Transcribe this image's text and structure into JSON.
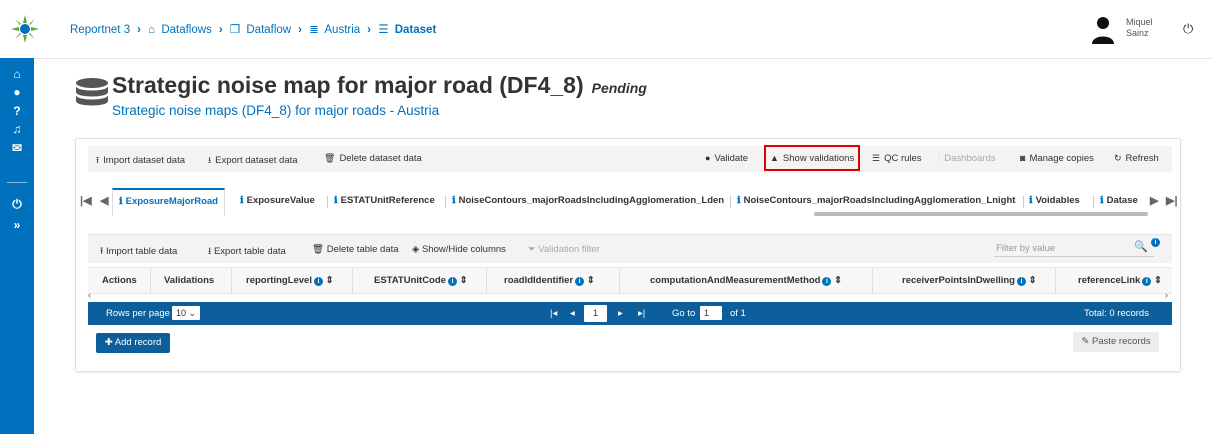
{
  "header": {
    "breadcrumb": [
      "Reportnet 3",
      "Dataflows",
      "Dataflow",
      "Austria",
      "Dataset"
    ],
    "user_first": "Miquel",
    "user_last": "Sainz"
  },
  "page": {
    "title": "Strategic noise map for major road (DF4_8)",
    "status": "Pending",
    "subtitle": "Strategic noise maps (DF4_8) for major roads - Austria"
  },
  "toolbar": {
    "import": "Import dataset data",
    "export": "Export dataset data",
    "delete": "Delete dataset data",
    "validate": "Validate",
    "show_validations": "Show validations",
    "qc_rules": "QC rules",
    "dashboards": "Dashboards",
    "manage_copies": "Manage copies",
    "refresh": "Refresh"
  },
  "tabs": [
    "ExposureMajorRoad",
    "ExposureValue",
    "ESTATUnitReference",
    "NoiseContours_majorRoadsIncludingAgglomeration_Lden",
    "NoiseContours_majorRoadsIncludingAgglomeration_Lnight",
    "Voidables",
    "Datase"
  ],
  "table_toolbar": {
    "import": "Import table data",
    "export": "Export table data",
    "delete": "Delete table data",
    "show_hide": "Show/Hide columns",
    "validation_filter": "Validation filter",
    "filter_placeholder": "Filter by value"
  },
  "columns": [
    "Actions",
    "Validations",
    "reportingLevel",
    "ESTATUnitCode",
    "roadIdIdentifier",
    "computationAndMeasurementMethod",
    "receiverPointsInDwelling",
    "referenceLink"
  ],
  "pagination": {
    "rows_label": "Rows per page",
    "rows_value": "10",
    "current_page": "1",
    "goto_label": "Go to",
    "goto_value": "1",
    "of_label": "of 1",
    "total": "Total: 0 records"
  },
  "buttons": {
    "add_record": "Add record",
    "paste_records": "Paste records"
  },
  "colors": {
    "brand": "#0071bc",
    "pager": "#0c5f9a",
    "highlight": "#e00000"
  }
}
